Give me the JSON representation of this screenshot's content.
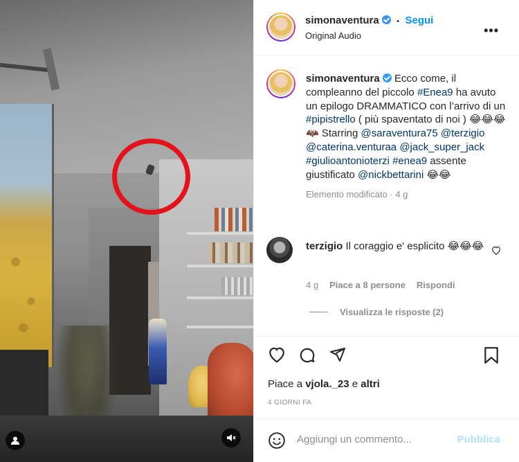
{
  "media": {
    "user_icon": "user-silhouette-icon",
    "mute_icon": "speaker-muted-icon",
    "highlight_color": "#e3121b"
  },
  "header": {
    "username": "simonaventura",
    "verified": true,
    "separator": "•",
    "follow_label": "Segui",
    "audio": "Original Audio",
    "more_icon": "more-options-icon",
    "more_label": "•••"
  },
  "caption": {
    "username": "simonaventura",
    "text_1": "Ecco come, il compleanno del piccolo ",
    "tag_1": "#Enea9",
    "text_2": " ha avuto un epilogo DRAMMATICO con l’arrivo di un ",
    "tag_2": "#pipistrello",
    "text_3": " ( più spaventato di noi ) 😂😂😂🦇 Starring ",
    "mention_1": "@saraventura75",
    "mention_2": "@terzigio",
    "mention_3": "@caterina.venturaa",
    "mention_4": "@jack_super_jack",
    "mention_5": "#giulioantonioterzi",
    "tag_3": "#enea9",
    "text_4": " assente giustificato ",
    "mention_6": "@nickbettarini",
    "text_5": " 😂😂",
    "meta": "Elemento modificato · 4 g"
  },
  "comment": {
    "username": "terzigio",
    "text": "Il coraggio e' esplicito 😂😂😂",
    "time": "4 g",
    "likes": "Piace a 8 persone",
    "reply_label": "Rispondi",
    "view_replies": "Visualizza le risposte (2)"
  },
  "actions": {
    "like_icon": "heart-icon",
    "comment_icon": "comment-bubble-icon",
    "share_icon": "paper-plane-icon",
    "save_icon": "bookmark-icon",
    "likes_prefix": "Piace a ",
    "likes_user": "vjola._23",
    "likes_suffix": " e ",
    "likes_others": "altri",
    "date": "4 GIORNI FA"
  },
  "add_comment": {
    "emoji_icon": "emoji-smiley-icon",
    "placeholder": "Aggiungi un commento...",
    "publish_label": "Pubblica"
  }
}
